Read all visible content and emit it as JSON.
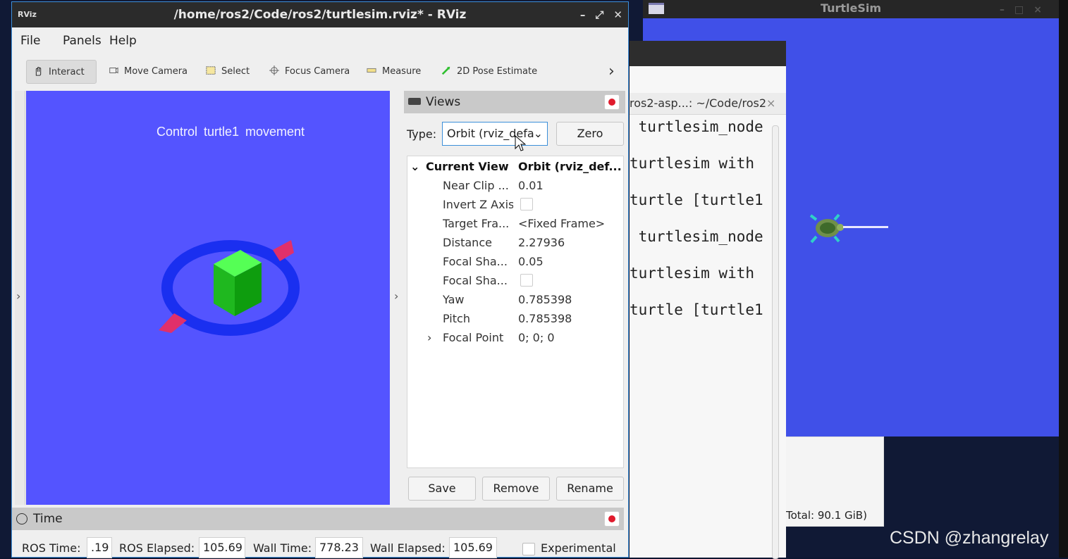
{
  "turtlesim": {
    "title": "TurtleSim",
    "bg_color": "#4050e8"
  },
  "system_monitor": {
    "total_text": "Total: 90.1 GiB)"
  },
  "terminal": {
    "tab_title": "ros2-asp...: ~/Code/ros2",
    "tab_close": "×",
    "lines": [
      " turtlesim_node",
      "turtlesim with",
      "turtle [turtle1",
      " turtlesim_node",
      "turtlesim with",
      "turtle [turtle1"
    ]
  },
  "rviz": {
    "title": "/home/ros2/Code/ros2/turtlesim.rviz* - RViz",
    "logo": "RViz",
    "menu": [
      "File",
      "Panels",
      "Help"
    ],
    "toolbar": [
      "Interact",
      "Move Camera",
      "Select",
      "Focus Camera",
      "Measure",
      "2D Pose Estimate"
    ],
    "toolbar_more": "›",
    "render_text": "Control  turtle1  movement",
    "render_bg": "#5454ff",
    "views": {
      "title": "Views",
      "type_label": "Type:",
      "type_value": "Orbit (rviz_defa",
      "zero_label": "Zero",
      "current_view_label": "Current View",
      "current_view_value": "Orbit (rviz_def...",
      "props": [
        {
          "key": "Near Clip ...",
          "value": "0.01"
        },
        {
          "key": "Invert Z Axis",
          "value": ""
        },
        {
          "key": "Target Fra...",
          "value": "<Fixed Frame>"
        },
        {
          "key": "Distance",
          "value": "2.27936"
        },
        {
          "key": "Focal Sha...",
          "value": "0.05"
        },
        {
          "key": "Focal Sha...",
          "value": ""
        },
        {
          "key": "Yaw",
          "value": "0.785398"
        },
        {
          "key": "Pitch",
          "value": "0.785398"
        },
        {
          "key": "Focal Point",
          "value": "0; 0; 0"
        }
      ],
      "buttons": [
        "Save",
        "Remove",
        "Rename"
      ]
    },
    "time": {
      "title": "Time",
      "ros_time_label": "ROS Time:",
      "ros_time": ".19",
      "ros_elapsed_label": "ROS Elapsed:",
      "ros_elapsed": "105.69",
      "wall_time_label": "Wall Time:",
      "wall_time": "778.23",
      "wall_elapsed_label": "Wall Elapsed:",
      "wall_elapsed": "105.69",
      "experimental_label": "Experimental"
    }
  },
  "watermark": "CSDN @zhangrelay"
}
